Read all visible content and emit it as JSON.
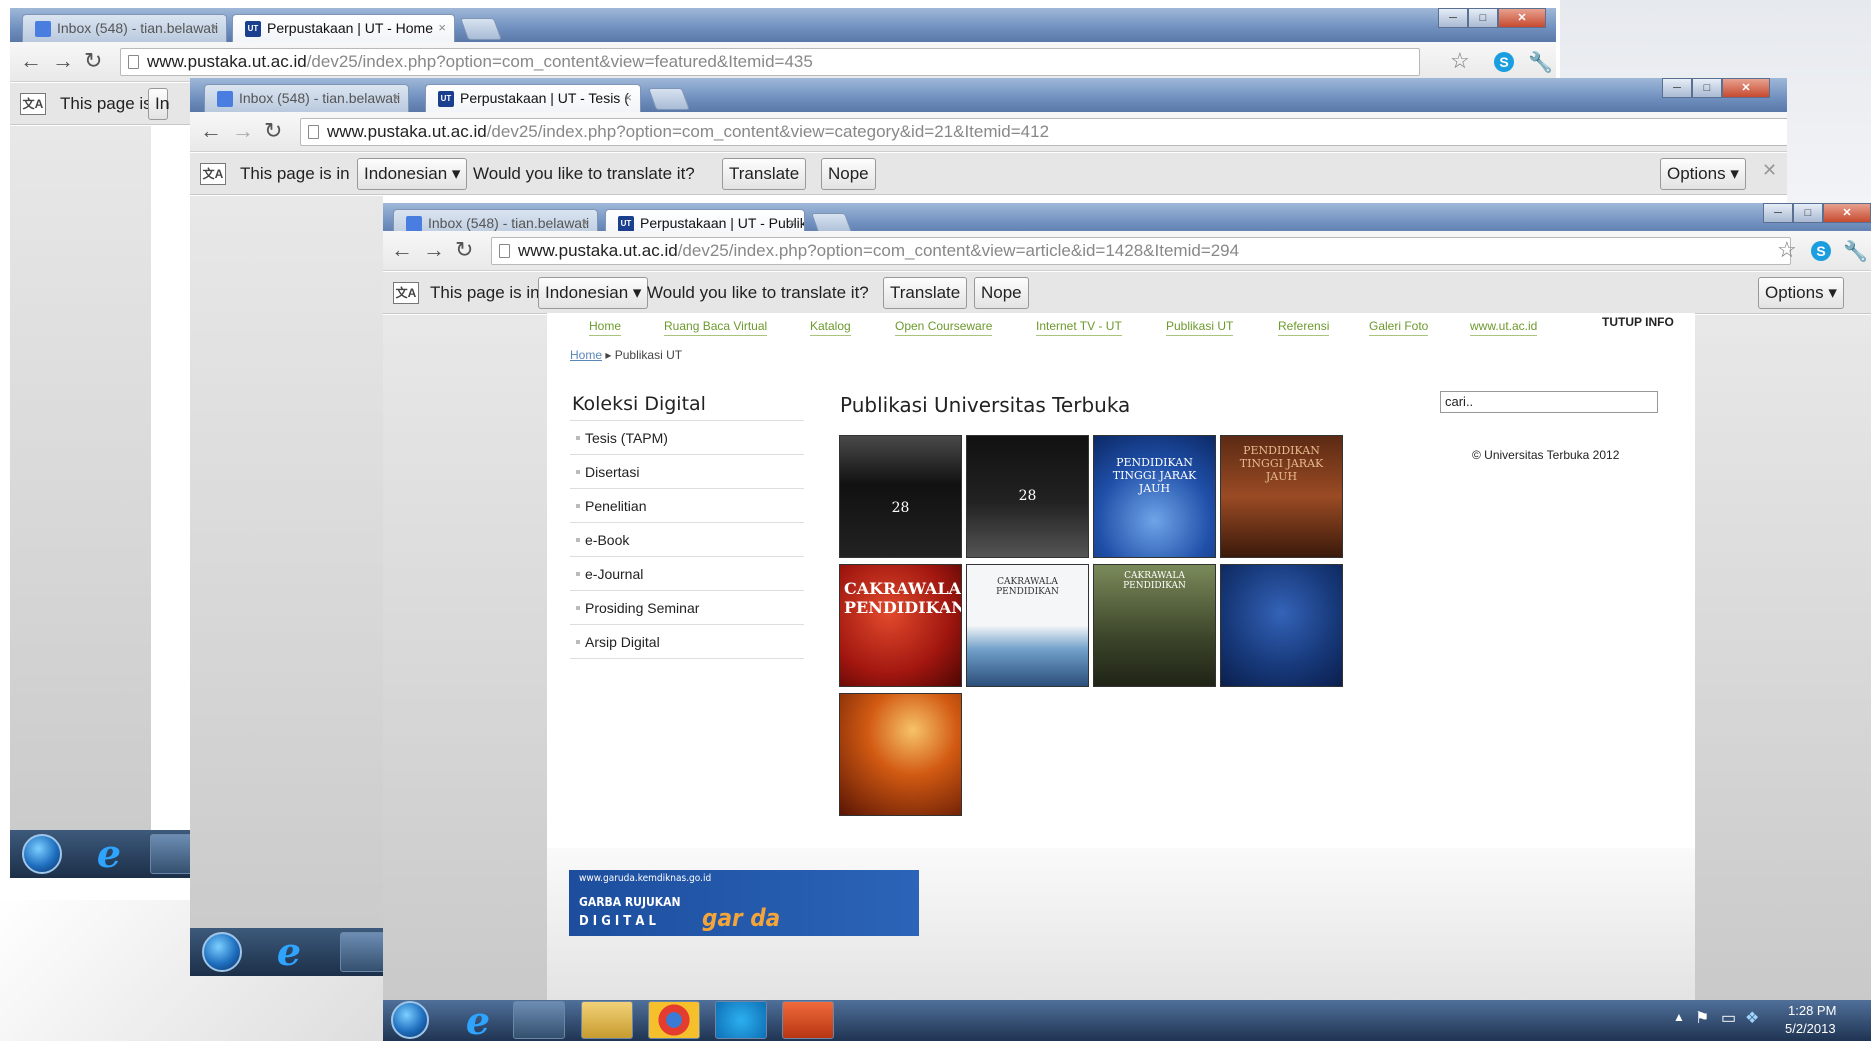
{
  "windows": [
    {
      "tabs": [
        {
          "label": "Inbox (548) - tian.belawati",
          "favicon": "gmail"
        },
        {
          "label": "Perpustakaan | UT - Home",
          "favicon": "ut",
          "active": true
        }
      ],
      "url_host": "www.pustaka.ut.ac.id",
      "url_path": "/dev25/index.php?option=com_content&view=featured&Itemid=435",
      "translate_text": "This page is in",
      "translate_fragment": "In"
    },
    {
      "tabs": [
        {
          "label": "Inbox (548) - tian.belawati",
          "favicon": "gmail"
        },
        {
          "label": "Perpustakaan | UT - Tesis (",
          "favicon": "ut",
          "active": true
        }
      ],
      "url_host": "www.pustaka.ut.ac.id",
      "url_path": "/dev25/index.php?option=com_content&view=category&id=21&Itemid=412",
      "translate_text": "This page is in",
      "language": "Indonesian",
      "question": "Would you like to translate it?",
      "translate_btn": "Translate",
      "nope_btn": "Nope",
      "options_btn": "Options"
    },
    {
      "tabs": [
        {
          "label": "Inbox (548) - tian.belawati",
          "favicon": "gmail"
        },
        {
          "label": "Perpustakaan | UT - Publik",
          "favicon": "ut",
          "active": true
        }
      ],
      "url_host": "www.pustaka.ut.ac.id",
      "url_path": "/dev25/index.php?option=com_content&view=article&id=1428&Itemid=294",
      "translate_text": "This page is in",
      "language": "Indonesian",
      "question": "Would you like to translate it?",
      "translate_btn": "Translate",
      "nope_btn": "Nope",
      "options_btn": "Options"
    }
  ],
  "site": {
    "menu": [
      "Home",
      "Ruang Baca Virtual",
      "Katalog",
      "Open Courseware",
      "Internet TV - UT",
      "Publikasi UT",
      "Referensi",
      "Galeri Foto",
      "www.ut.ac.id"
    ],
    "tutup_info": "TUTUP INFO",
    "breadcrumb": {
      "home": "Home",
      "sep": "▸",
      "current": "Publikasi UT"
    },
    "sidebar_title": "Koleksi Digital",
    "sidebar_items": [
      "Tesis (TAPM)",
      "Disertasi",
      "Penelitian",
      "e-Book",
      "e-Journal",
      "Prosiding Seminar",
      "Arsip Digital"
    ],
    "main_title": "Publikasi Universitas Terbuka",
    "search_placeholder": "cari..",
    "copyright": "© Universitas Terbuka 2012",
    "covers": [
      {
        "text": "28",
        "bg": "#1a1a1a"
      },
      {
        "text": "28",
        "bg": "#111111"
      },
      {
        "text": "PENDIDIKAN TINGGI JARAK JAUH",
        "bg": "#1f4fa8"
      },
      {
        "text": "PENDIDIKAN TINGGI JARAK JAUH",
        "bg": "#7a3a1e"
      },
      {
        "text": "CAKRAWALA PENDIDIKAN",
        "bg": "#b3201a"
      },
      {
        "text": "CAKRAWALA PENDIDIKAN",
        "bg": "#e8eef4"
      },
      {
        "text": "CAKRAWALA PENDIDIKAN",
        "bg": "#4f5a3a"
      },
      {
        "text": "",
        "bg": "#1d3d8c"
      },
      {
        "text": "",
        "bg": "#a8320e"
      }
    ],
    "banner": {
      "url": "www.garuda.kemdiknas.go.id",
      "line1": "GARBA RUJUKAN",
      "line2": "D I G I T A L",
      "logo": "gar da"
    }
  },
  "taskbar": {
    "time": "1:28 PM",
    "date": "5/2/2013"
  }
}
